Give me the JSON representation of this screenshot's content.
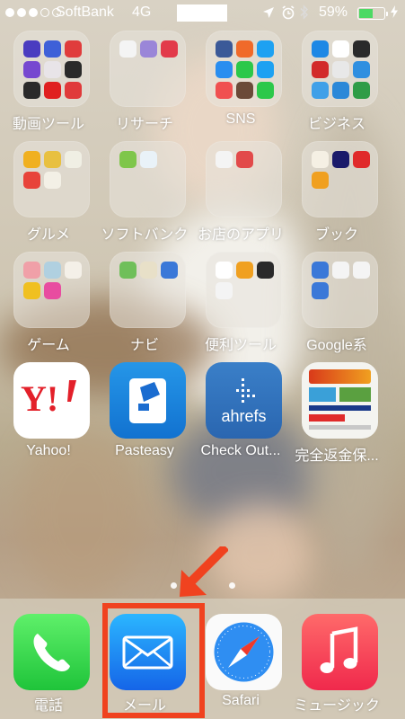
{
  "status_bar": {
    "signal_dots": [
      true,
      true,
      true,
      false,
      false
    ],
    "carrier": "SoftBank",
    "network": "4G",
    "battery_percent": "59%",
    "battery_level": 0.59,
    "icons": [
      "location-arrow-icon",
      "alarm-clock-icon",
      "bluetooth-icon",
      "charging-bolt-icon"
    ]
  },
  "home": {
    "rows": [
      [
        {
          "type": "folder",
          "label": "動画ツール",
          "icon": "video-tools-folder",
          "minis": [
            "#4a3cc0",
            "#3e60d8",
            "#e03c3c",
            "#7648d0",
            "#e8e4e8",
            "#2a2a2a",
            "#2a2a2a",
            "#e02020",
            "#e03a3a"
          ]
        },
        {
          "type": "folder",
          "label": "リサーチ",
          "icon": "research-folder",
          "minis": [
            "#f4f4f4",
            "#9a86d8",
            "#e23a4a"
          ]
        },
        {
          "type": "folder",
          "label": "SNS",
          "icon": "sns-folder",
          "minis": [
            "#3b5998",
            "#f06a2a",
            "#1da1f2",
            "#2a8ef0",
            "#2cc84a",
            "#1da1f2",
            "#f05050",
            "#6b4a38",
            "#2cc84a"
          ]
        },
        {
          "type": "folder",
          "label": "ビジネス",
          "icon": "business-folder",
          "minis": [
            "#1e88e5",
            "#ffffff",
            "#2a2a2a",
            "#d22a2a",
            "#e8e8e8",
            "#2f8fe0",
            "#40a0e8",
            "#2b88d8",
            "#2f9c46"
          ]
        }
      ],
      [
        {
          "type": "folder",
          "label": "グルメ",
          "icon": "gourmet-folder",
          "minis": [
            "#f0b020",
            "#e8c040",
            "#f0efe4",
            "#e8433a",
            "#f3f0e6"
          ]
        },
        {
          "type": "folder",
          "label": "ソフトバンク",
          "icon": "softbank-folder",
          "minis": [
            "#7fc64a",
            "#e9f2f8"
          ]
        },
        {
          "type": "folder",
          "label": "お店のアプリ",
          "icon": "store-apps-folder",
          "minis": [
            "#f4f4f4",
            "#e24a4a"
          ]
        },
        {
          "type": "folder",
          "label": "ブック",
          "icon": "book-folder",
          "minis": [
            "#f5f0e4",
            "#1a1a6a",
            "#e02a2a",
            "#f0a020"
          ]
        }
      ],
      [
        {
          "type": "folder",
          "label": "ゲーム",
          "icon": "game-folder",
          "minis": [
            "#f0a0a8",
            "#b0d0e0",
            "#f4f0e8",
            "#f0c020",
            "#e84ca0"
          ]
        },
        {
          "type": "folder",
          "label": "ナビ",
          "icon": "navi-folder",
          "minis": [
            "#6fbf5a",
            "#e8e0c8",
            "#3a78d8"
          ]
        },
        {
          "type": "folder",
          "label": "便利ツール",
          "icon": "utility-tools-folder",
          "minis": [
            "#ffffff",
            "#f0a020",
            "#2a2a2a",
            "#f4f4f4"
          ]
        },
        {
          "type": "folder",
          "label": "Google系",
          "icon": "google-apps-folder",
          "minis": [
            "#3a78d8",
            "#f4f4f4",
            "#f4f4f4",
            "#3a78d8"
          ]
        }
      ],
      [
        {
          "type": "app",
          "label": "Yahoo!",
          "icon": "yahoo-app-icon"
        },
        {
          "type": "app",
          "label": "Pasteasy",
          "icon": "pasteasy-app-icon"
        },
        {
          "type": "app",
          "label": "Check Out...",
          "icon": "ahrefs-app-icon",
          "logo_text": "ahrefs"
        },
        {
          "type": "app",
          "label": "完全返金保...",
          "icon": "refund-guarantee-app-icon"
        }
      ]
    ],
    "page_dots": 2,
    "current_page": 1
  },
  "dock": [
    {
      "label": "電話",
      "icon": "phone-app-icon"
    },
    {
      "label": "メール",
      "icon": "mail-app-icon"
    },
    {
      "label": "Safari",
      "icon": "safari-app-icon"
    },
    {
      "label": "ミュージック",
      "icon": "music-app-icon"
    }
  ],
  "annotation": {
    "color": "#f0421f",
    "target": "mail-app-icon"
  }
}
